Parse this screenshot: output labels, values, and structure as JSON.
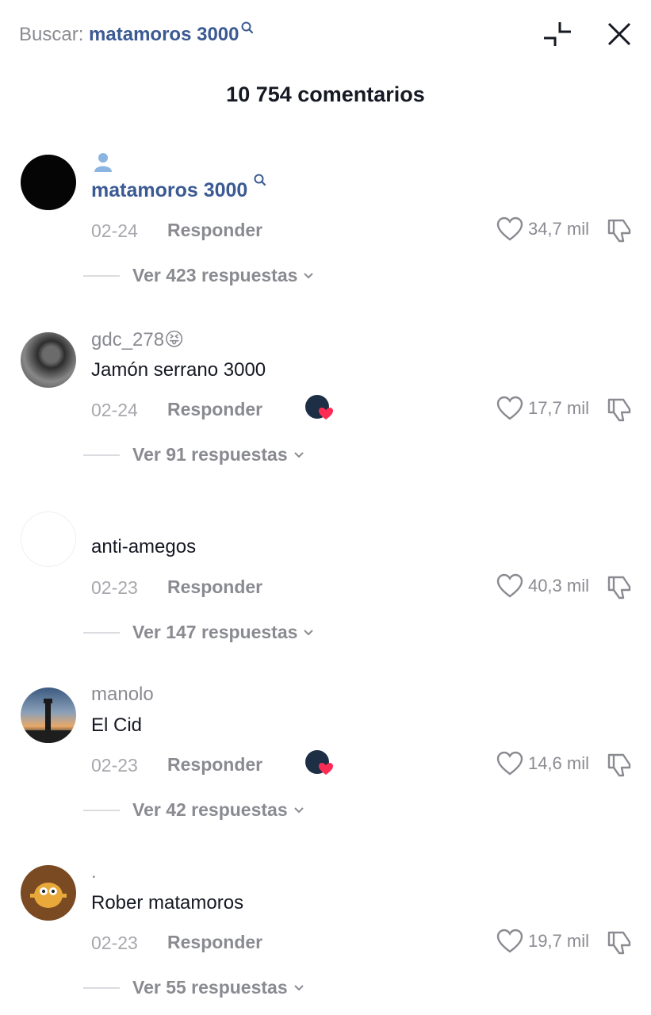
{
  "header": {
    "search_prefix": "Buscar:",
    "search_query": "matamoros 3000",
    "comment_count": "10 754 comentarios"
  },
  "colors": {
    "link": "#3b5a93",
    "muted": "#8a8b91",
    "like_badge": "#fe2c55"
  },
  "comments": [
    {
      "username": "matamoros 3000",
      "text": "",
      "date": "02-24",
      "reply_label": "Responder",
      "likes": "34,7 mil",
      "view_replies": "Ver 423 respuestas",
      "icon": "person-icon",
      "creator_liked": false
    },
    {
      "username": "gdc_278",
      "username_emoji": "😝",
      "text": "Jamón serrano 3000",
      "date": "02-24",
      "reply_label": "Responder",
      "likes": "17,7 mil",
      "view_replies": "Ver 91 respuestas",
      "creator_liked": true
    },
    {
      "username": "",
      "text": "anti-amegos",
      "date": "02-23",
      "reply_label": "Responder",
      "likes": "40,3 mil",
      "view_replies": "Ver 147 respuestas",
      "creator_liked": false
    },
    {
      "username": "manolo",
      "text": "El Cid",
      "date": "02-23",
      "reply_label": "Responder",
      "likes": "14,6 mil",
      "view_replies": "Ver 42 respuestas",
      "creator_liked": true
    },
    {
      "username": ".",
      "text": "Rober matamoros",
      "date": "02-23",
      "reply_label": "Responder",
      "likes": "19,7 mil",
      "view_replies": "Ver 55 respuestas",
      "creator_liked": false
    }
  ]
}
